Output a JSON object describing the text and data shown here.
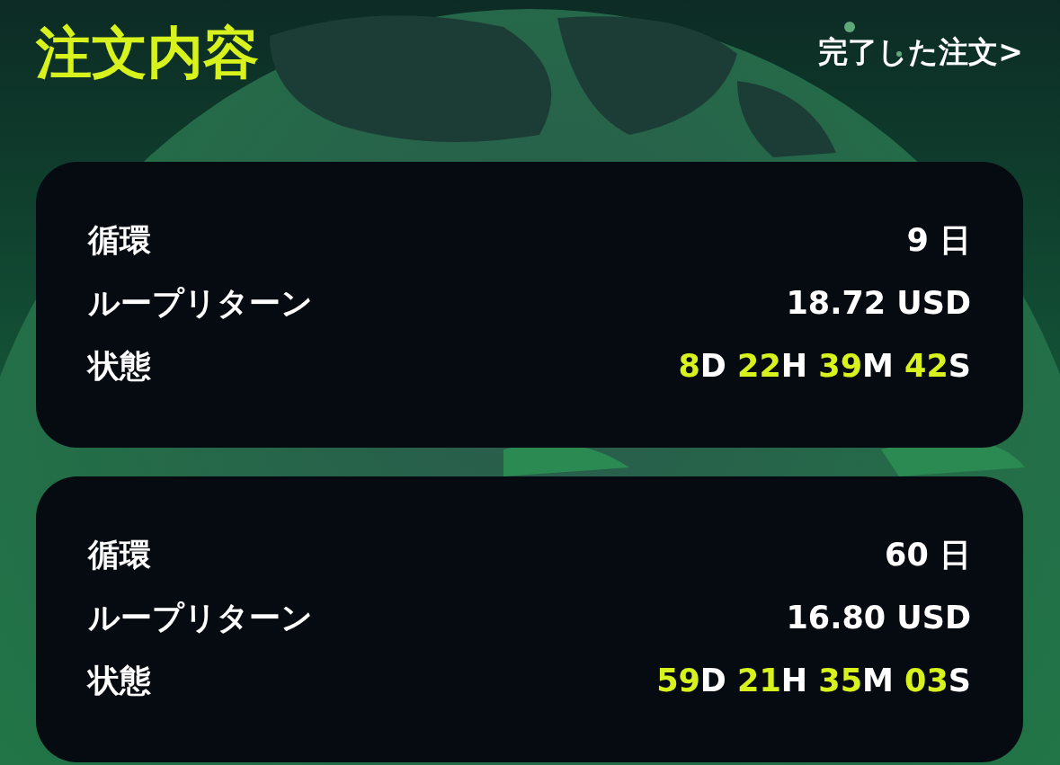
{
  "header": {
    "title": "注文内容",
    "link": "完了した注文>"
  },
  "orders": [
    {
      "rows": [
        {
          "label": "循環",
          "value": "9 日"
        },
        {
          "label": "ループリターン",
          "value": "18.72 USD"
        }
      ],
      "status_label": "状態",
      "countdown": [
        {
          "number": "8",
          "unit": "D"
        },
        {
          "number": "22",
          "unit": "H"
        },
        {
          "number": "39",
          "unit": "M"
        },
        {
          "number": "42",
          "unit": "S"
        }
      ]
    },
    {
      "rows": [
        {
          "label": "循環",
          "value": "60 日"
        },
        {
          "label": "ループリターン",
          "value": "16.80 USD"
        }
      ],
      "status_label": "状態",
      "countdown": [
        {
          "number": "59",
          "unit": "D"
        },
        {
          "number": "21",
          "unit": "H"
        },
        {
          "number": "35",
          "unit": "M"
        },
        {
          "number": "03",
          "unit": "S"
        }
      ]
    }
  ]
}
